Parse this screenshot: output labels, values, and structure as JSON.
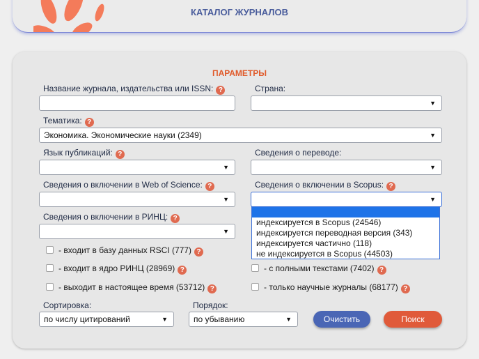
{
  "header": {
    "title": "КАТАЛОГ ЖУРНАЛОВ"
  },
  "params": {
    "title": "ПАРАМЕТРЫ",
    "help_glyph": "?",
    "journal_name": {
      "label": "Название журнала, издательства или ISSN:",
      "value": ""
    },
    "country": {
      "label": "Страна:",
      "value": ""
    },
    "subject": {
      "label": "Тематика:",
      "value": "Экономика. Экономические науки  (2349)"
    },
    "language": {
      "label": "Язык публикаций:",
      "value": ""
    },
    "translation": {
      "label": "Сведения о переводе:",
      "value": ""
    },
    "wos": {
      "label": "Сведения о включении в Web of Science:",
      "value": ""
    },
    "scopus": {
      "label": "Сведения о включении в Scopus:",
      "value": "",
      "options": [
        "индексируется в Scopus  (24546)",
        "индексируется переводная версия  (343)",
        "индексируется частично  (118)",
        "не индексируется в Scopus  (44503)"
      ]
    },
    "rinc": {
      "label": "Сведения о включении в РИНЦ:",
      "value": ""
    },
    "checkboxes": {
      "rsci": "- входит в базу данных RSCI (777)",
      "core": "- входит в ядро РИНЦ (28969)",
      "current": "- выходит в настоящее время (53712)",
      "fulltext": "- с полными текстами (7402)",
      "scientific": "- только научные журналы (68177)"
    },
    "sort": {
      "label": "Сортировка:",
      "value": "по числу цитирований"
    },
    "order": {
      "label": "Порядок:",
      "value": "по убыванию"
    },
    "clear_label": "Очистить",
    "search_label": "Поиск"
  },
  "arrow_glyph": "▼"
}
